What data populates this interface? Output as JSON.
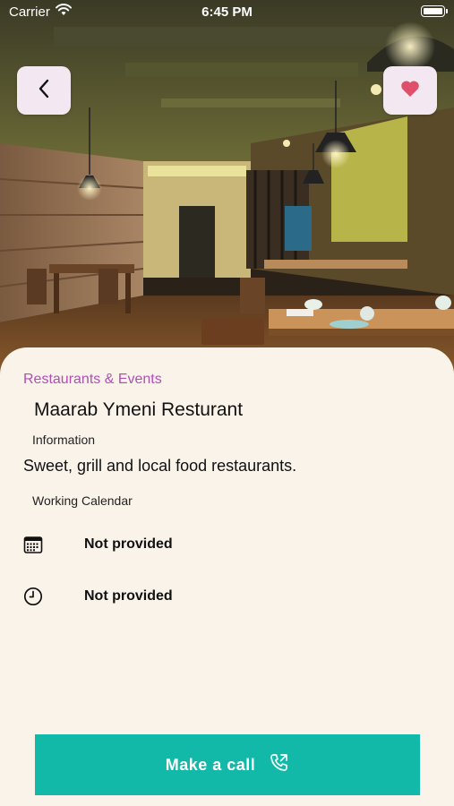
{
  "status_bar": {
    "carrier": "Carrier",
    "time": "6:45 PM",
    "icons": [
      "wifi-icon",
      "battery-icon"
    ]
  },
  "hero": {
    "image": "restaurant-interior-photo"
  },
  "nav": {
    "back_icon": "chevron-left-icon",
    "favorite_icon": "heart-icon",
    "favorite_color": "#e04f6a",
    "button_background": "#f3e8f2"
  },
  "place": {
    "category": "Restaurants & Events",
    "name": "Maarab Ymeni Resturant",
    "information_heading": "Information",
    "description": "Sweet, grill and local food restaurants.",
    "working_calendar_heading": "Working Calendar",
    "working_days": "Not provided",
    "working_hours": "Not provided"
  },
  "action": {
    "call_label": "Make a call",
    "call_icon": "phone-outgoing-icon"
  },
  "colors": {
    "accent": "#b04fb6",
    "call_button": "#12b9a8",
    "background": "#faf3ea"
  }
}
